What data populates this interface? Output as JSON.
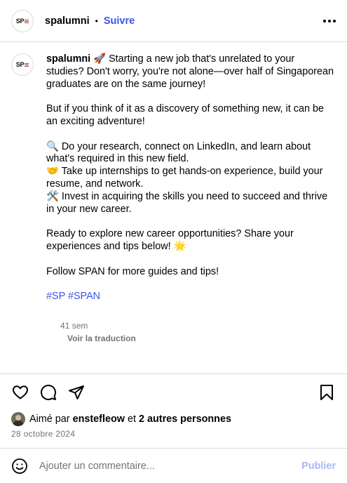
{
  "header": {
    "avatar_text": "SP",
    "username": "spalumni",
    "separator": "•",
    "follow_label": "Suivre"
  },
  "caption": {
    "username": "spalumni",
    "paragraphs": [
      "🚀 Starting a new job that's unrelated to your studies? Don't worry, you're not alone—over half of Singaporean graduates are on the same journey!",
      "But if you think of it as a discovery of something new, it can be an exciting adventure!",
      "🔍 Do your research, connect on LinkedIn, and learn about what's required in this new field.\n🤝 Take up internships to get hands-on experience, build your resume, and network.\n🛠️ Invest in acquiring the skills you need to succeed and thrive in your new career.",
      "Ready to explore new career opportunities? Share your experiences and tips below! 🌟",
      "Follow SPAN for more guides and tips!"
    ],
    "hashtags": "#SP #SPAN",
    "age": "41 sem",
    "translate_label": "Voir la traduction"
  },
  "actions": {
    "icons": [
      "heart-icon",
      "comment-icon",
      "share-icon",
      "bookmark-icon"
    ]
  },
  "likes": {
    "prefix": "Aimé par",
    "user": "enstefleow",
    "conjunction": "et",
    "others": "2 autres personnes"
  },
  "date": "28 octobre 2024",
  "comment": {
    "placeholder": "Ajouter un commentaire...",
    "post_label": "Publier"
  },
  "colors": {
    "link": "#3b55e6",
    "post_disabled": "#a6b9f5",
    "muted": "#737373",
    "border": "#dbdbdb"
  }
}
